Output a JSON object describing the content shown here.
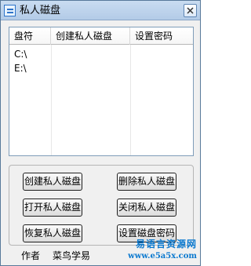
{
  "window": {
    "title": "私人磁盘",
    "close_icon": "close-icon",
    "app_icon": "app-icon"
  },
  "table": {
    "columns": [
      "盘符",
      "创建私人磁盘",
      "设置密码"
    ],
    "rows": [
      [
        "C:\\",
        "",
        ""
      ],
      [
        "E:\\",
        "",
        ""
      ]
    ]
  },
  "buttons": {
    "create": "创建私人磁盘",
    "delete": "删除私人磁盘",
    "open": "打开私人磁盘",
    "close": "关闭私人磁盘",
    "restore": "恢复私人磁盘",
    "set_password": "设置磁盘密码"
  },
  "footer": {
    "author_label": "作者",
    "author_name": "菜鸟学易"
  },
  "watermark": {
    "cn": "易语言资源网",
    "url": "www.e5a5x.com"
  },
  "colors": {
    "titlebar": "#b3cbe7",
    "window_border": "#58799a",
    "watermark": "#0b79cf"
  }
}
